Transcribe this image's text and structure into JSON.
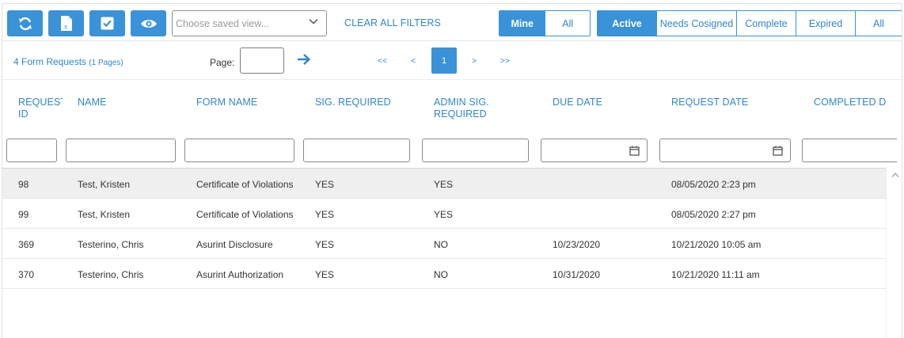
{
  "toolbar": {
    "buttons": [
      {
        "icon": "refresh-icon"
      },
      {
        "icon": "excel-export-icon",
        "label": "x"
      },
      {
        "icon": "checkbox-icon"
      },
      {
        "icon": "eye-icon"
      }
    ],
    "saved_view": {
      "placeholder": "Choose saved view..."
    },
    "clear_filters": "CLEAR ALL FILTERS",
    "owner_filter": [
      {
        "label": "Mine",
        "active": true
      },
      {
        "label": "All",
        "active": false
      }
    ],
    "status_filter": [
      {
        "label": "Active",
        "active": true
      },
      {
        "label": "Needs Cosigned",
        "active": false
      },
      {
        "label": "Complete",
        "active": false
      },
      {
        "label": "Expired",
        "active": false
      },
      {
        "label": "All",
        "active": false
      }
    ],
    "accent": "#3a92d8"
  },
  "pager": {
    "count": "4 Form Requests",
    "pages": "(1 Pages)",
    "page_label": "Page:",
    "first": "<<",
    "prev": "<",
    "current": "1",
    "next": ">",
    "last": ">>"
  },
  "columns": [
    {
      "label": "REQUEST\nID",
      "filter": "text"
    },
    {
      "label": "NAME",
      "filter": "text"
    },
    {
      "label": "FORM NAME",
      "filter": "text"
    },
    {
      "label": "SIG. REQUIRED",
      "filter": "text"
    },
    {
      "label": "ADMIN SIG.\nREQUIRED",
      "filter": "text"
    },
    {
      "label": "DUE DATE",
      "filter": "date"
    },
    {
      "label": "REQUEST DATE",
      "filter": "date"
    },
    {
      "label": "COMPLETED DA",
      "filter": "text"
    }
  ],
  "rows": [
    {
      "id": "98",
      "name": "Test, Kristen",
      "form": "Certificate of Violations",
      "sig": "YES",
      "admin_sig": "YES",
      "due": "",
      "requested": "08/05/2020 2:23 pm",
      "completed": ""
    },
    {
      "id": "99",
      "name": "Test, Kristen",
      "form": "Certificate of Violations",
      "sig": "YES",
      "admin_sig": "YES",
      "due": "",
      "requested": "08/05/2020 2:27 pm",
      "completed": ""
    },
    {
      "id": "369",
      "name": "Testerino, Chris",
      "form": "Asurint Disclosure",
      "sig": "YES",
      "admin_sig": "NO",
      "due": "10/23/2020",
      "requested": "10/21/2020 10:05 am",
      "completed": ""
    },
    {
      "id": "370",
      "name": "Testerino, Chris",
      "form": "Asurint Authorization",
      "sig": "YES",
      "admin_sig": "NO",
      "due": "10/31/2020",
      "requested": "10/21/2020 11:11 am",
      "completed": ""
    }
  ]
}
